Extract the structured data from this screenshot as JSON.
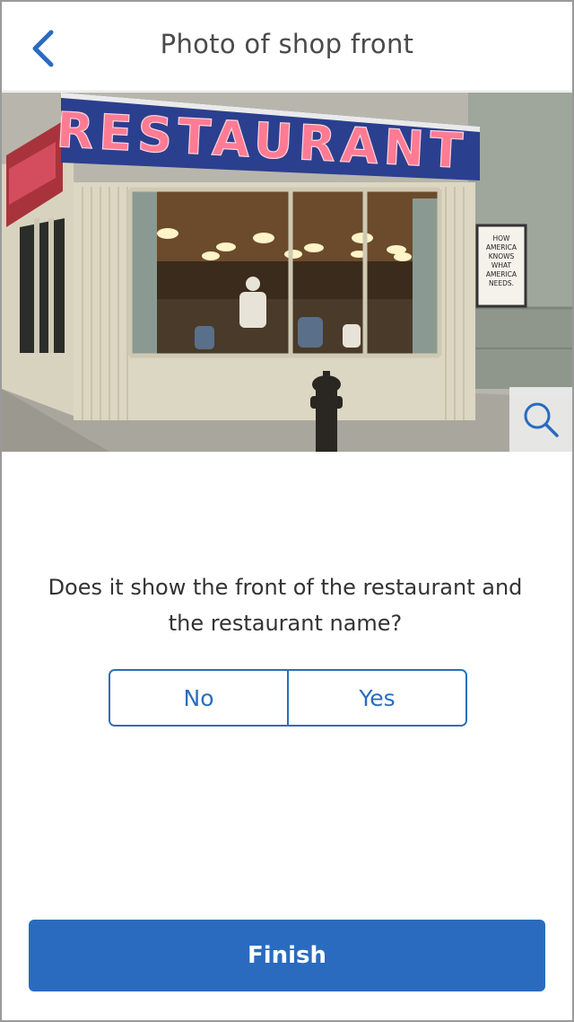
{
  "header": {
    "title": "Photo of shop front",
    "back_icon": "chevron-left-icon"
  },
  "photo": {
    "sign_text": "RESTAURANT",
    "poster_lines": [
      "HOW",
      "AMERICA",
      "KNOWS",
      "WHAT",
      "AMERICA",
      "NEEDS."
    ],
    "zoom_icon": "magnifier-icon"
  },
  "question": {
    "text": "Does it show the front of the restaurant and the restaurant name?",
    "options": {
      "no": "No",
      "yes": "Yes"
    }
  },
  "footer": {
    "finish_label": "Finish"
  },
  "colors": {
    "accent": "#2a6bbf",
    "sign_background": "#2b3f8f",
    "sign_neon": "#ff6f8a"
  }
}
